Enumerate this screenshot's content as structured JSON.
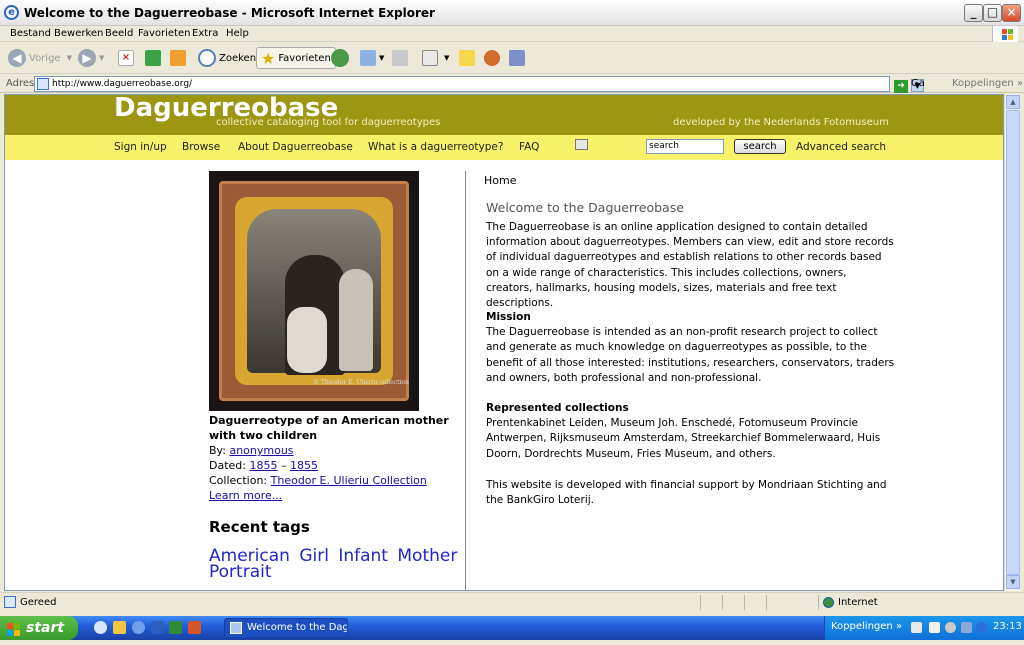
{
  "window": {
    "title": "Welcome to the Daguerreobase - Microsoft Internet Explorer",
    "controls": [
      "_",
      "□",
      "×"
    ]
  },
  "menu": [
    "Bestand",
    "Bewerken",
    "Beeld",
    "Favorieten",
    "Extra",
    "Help"
  ],
  "toolbar": {
    "back": "Vorige",
    "search": "Zoeken",
    "favorites": "Favorieten"
  },
  "address": {
    "label": "Adres",
    "url": "http://www.daguerreobase.org/",
    "go": "Ga naar",
    "links": "Koppelingen"
  },
  "site": {
    "logo": "Daguerreobase",
    "tagline": "collective cataloging tool for daguerreotypes",
    "developer": "developed by the Nederlands Fotomuseum",
    "nav": [
      "Sign in/up",
      "Browse",
      "About Daguerreobase",
      "What is a daguerreotype?",
      "FAQ"
    ],
    "search_value": "search",
    "search_button": "search",
    "advanced_search": "Advanced search"
  },
  "featured": {
    "photo_credit": "© Theodor E. Ulieriu collection",
    "title": "Daguerreotype of an American mother with two children",
    "by_label": "By:",
    "by": "anonymous",
    "dated_label": "Dated:",
    "date_from": "1855",
    "date_sep": "–",
    "date_to": "1855",
    "collection_label": "Collection:",
    "collection": "Theodor E. Ulieriu Collection",
    "learn_more": "Learn more..."
  },
  "recent_tags": {
    "heading": "Recent tags",
    "tags": [
      "American",
      "Girl",
      "Infant",
      "Mother",
      "Portrait"
    ]
  },
  "content": {
    "breadcrumb": "Home",
    "heading": "Welcome to the Daguerreobase",
    "intro": "The Daguerreobase is an online application designed to contain detailed information about daguerreotypes. Members can view, edit and store records of individual daguerreotypes and establish relations to other records based on a wide range of characteristics. This includes collections, owners, creators, hallmarks, housing models, sizes, materials and free text descriptions.",
    "mission_heading": "Mission",
    "mission": "The Daguerreobase is intended as an non-profit research project to collect and generate as much knowledge on daguerreotypes as possible, to the benefit of all those interested: institutions, researchers, conservators, traders and owners, both professional and non-professional.",
    "collections_heading": "Represented collections",
    "collections": "Prentenkabinet Leiden, Museum Joh. Enschedé, Fotomuseum Provincie Antwerpen, Rijksmuseum Amsterdam, Streekarchief Bommelerwaard, Huis Doorn, Dordrechts Museum, Fries Museum, and others.",
    "support": "This website is developed with financial support by Mondriaan Stichting and the BankGiro Loterij."
  },
  "status": {
    "text": "Gereed",
    "zone": "Internet"
  },
  "taskbar": {
    "start": "start",
    "task": "Welcome to the Dagu...",
    "links": "Koppelingen",
    "clock": "23:13"
  },
  "colors": {
    "banner": "#9c9612",
    "navbar": "#f7f26a",
    "link": "#1a0dab",
    "tags": "#1e28c8"
  }
}
